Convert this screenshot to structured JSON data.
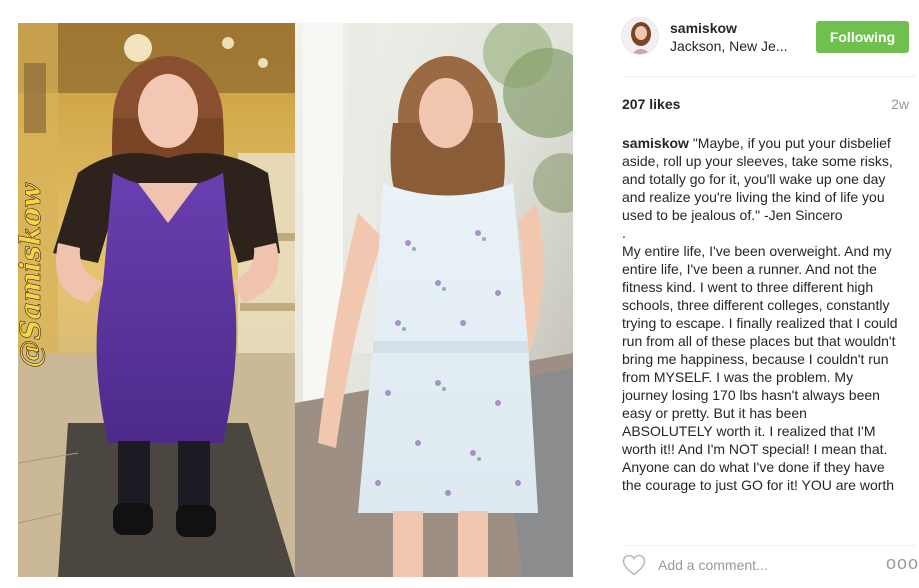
{
  "photo": {
    "watermark": "@Samiskow",
    "alt": "Before and after photo"
  },
  "header": {
    "username": "samiskow",
    "location": "Jackson, New Je...",
    "follow_label": "Following"
  },
  "stats": {
    "likes": "207 likes",
    "age": "2w"
  },
  "caption": {
    "username": "samiskow",
    "quote": "\"Maybe, if you put your disbelief aside, roll up your sleeves, take some risks, and totally go for it, you'll wake up one day and realize you're living the kind of life you used to be jealous of.\" -Jen Sincero",
    "separator": ".",
    "body": "My entire life, I've been overweight. And my entire life, I've been a runner. And not the fitness kind. I went to three different high schools, three different colleges, constantly trying to escape. I finally realized that I could run from all of these places but that wouldn't bring me happiness, because I couldn't run from MYSELF. I was the problem. My journey losing 170 lbs hasn't always been easy or pretty. But it has been ABSOLUTELY worth it. I realized that I'M worth it!! And I'm NOT special! I mean that. Anyone can do what I've done if they have the courage to just GO for it! YOU are worth"
  },
  "comment": {
    "placeholder": "Add a comment...",
    "more_label": "ooo"
  },
  "colors": {
    "follow_green": "#70c050",
    "text": "#262626",
    "muted": "#999999",
    "divider": "#efefef"
  },
  "icons": {
    "like": "heart-icon",
    "more": "more-options-icon"
  }
}
